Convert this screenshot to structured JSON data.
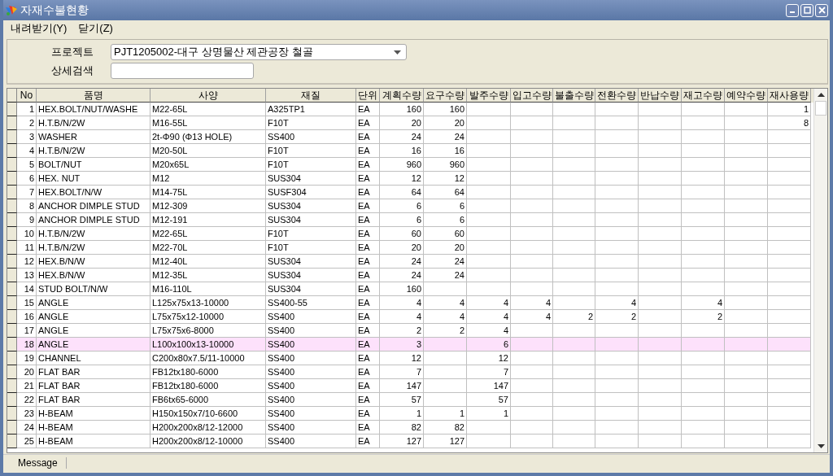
{
  "window": {
    "title": "자재수불현황"
  },
  "menu": [
    "내려받기(Y)",
    "닫기(Z)"
  ],
  "form": {
    "project_label": "프로젝트",
    "project_value": "PJT1205002-대구 상명물산 제관공장 철골",
    "search_label": "상세검색"
  },
  "table": {
    "columns": [
      "No",
      "품명",
      "사양",
      "재질",
      "단위",
      "계획수량",
      "요구수량",
      "발주수량",
      "입고수량",
      "불출수량",
      "전환수량",
      "반납수량",
      "재고수량",
      "예약수량",
      "재사용량"
    ],
    "rows": [
      {
        "selected": false,
        "cells": [
          "1",
          "HEX.BOLT/NUT/WASHE",
          "M22-65L",
          "A325TP1",
          "EA",
          "160",
          "160",
          null,
          null,
          null,
          null,
          null,
          null,
          null,
          "1"
        ]
      },
      {
        "selected": false,
        "cells": [
          "2",
          "H.T.B/N/2W",
          "M16-55L",
          "F10T",
          "EA",
          "20",
          "20",
          null,
          null,
          null,
          null,
          null,
          null,
          null,
          "8"
        ]
      },
      {
        "selected": false,
        "cells": [
          "3",
          "WASHER",
          "2t-Φ90 (Φ13 HOLE)",
          "SS400",
          "EA",
          "24",
          "24",
          null,
          null,
          null,
          null,
          null,
          null,
          null,
          null
        ]
      },
      {
        "selected": false,
        "cells": [
          "4",
          "H.T.B/N/2W",
          "M20-50L",
          "F10T",
          "EA",
          "16",
          "16",
          null,
          null,
          null,
          null,
          null,
          null,
          null,
          null
        ]
      },
      {
        "selected": false,
        "cells": [
          "5",
          "BOLT/NUT",
          "M20x65L",
          "F10T",
          "EA",
          "960",
          "960",
          null,
          null,
          null,
          null,
          null,
          null,
          null,
          null
        ]
      },
      {
        "selected": false,
        "cells": [
          "6",
          "HEX. NUT",
          "M12",
          "SUS304",
          "EA",
          "12",
          "12",
          null,
          null,
          null,
          null,
          null,
          null,
          null,
          null
        ]
      },
      {
        "selected": false,
        "cells": [
          "7",
          "HEX.BOLT/N/W",
          "M14-75L",
          "SUSF304",
          "EA",
          "64",
          "64",
          null,
          null,
          null,
          null,
          null,
          null,
          null,
          null
        ]
      },
      {
        "selected": false,
        "cells": [
          "8",
          "ANCHOR DIMPLE STUD",
          "M12-309",
          "SUS304",
          "EA",
          "6",
          "6",
          null,
          null,
          null,
          null,
          null,
          null,
          null,
          null
        ]
      },
      {
        "selected": false,
        "cells": [
          "9",
          "ANCHOR DIMPLE STUD",
          "M12-191",
          "SUS304",
          "EA",
          "6",
          "6",
          null,
          null,
          null,
          null,
          null,
          null,
          null,
          null
        ]
      },
      {
        "selected": false,
        "cells": [
          "10",
          "H.T.B/N/2W",
          "M22-65L",
          "F10T",
          "EA",
          "60",
          "60",
          null,
          null,
          null,
          null,
          null,
          null,
          null,
          null
        ]
      },
      {
        "selected": false,
        "cells": [
          "11",
          "H.T.B/N/2W",
          "M22-70L",
          "F10T",
          "EA",
          "20",
          "20",
          null,
          null,
          null,
          null,
          null,
          null,
          null,
          null
        ]
      },
      {
        "selected": false,
        "cells": [
          "12",
          "HEX.B/N/W",
          "M12-40L",
          "SUS304",
          "EA",
          "24",
          "24",
          null,
          null,
          null,
          null,
          null,
          null,
          null,
          null
        ]
      },
      {
        "selected": false,
        "cells": [
          "13",
          "HEX.B/N/W",
          "M12-35L",
          "SUS304",
          "EA",
          "24",
          "24",
          null,
          null,
          null,
          null,
          null,
          null,
          null,
          null
        ]
      },
      {
        "selected": false,
        "cells": [
          "14",
          "STUD BOLT/N/W",
          "M16-110L",
          "SUS304",
          "EA",
          "160",
          null,
          null,
          null,
          null,
          null,
          null,
          null,
          null,
          null
        ]
      },
      {
        "selected": false,
        "cells": [
          "15",
          "ANGLE",
          "L125x75x13-10000",
          "SS400-55",
          "EA",
          "4",
          "4",
          "4",
          "4",
          null,
          "4",
          null,
          "4",
          null,
          null
        ]
      },
      {
        "selected": false,
        "cells": [
          "16",
          "ANGLE",
          "L75x75x12-10000",
          "SS400",
          "EA",
          "4",
          "4",
          "4",
          "4",
          "2",
          "2",
          null,
          "2",
          null,
          null
        ]
      },
      {
        "selected": false,
        "cells": [
          "17",
          "ANGLE",
          "L75x75x6-8000",
          "SS400",
          "EA",
          "2",
          "2",
          "4",
          null,
          null,
          null,
          null,
          null,
          null,
          null
        ]
      },
      {
        "selected": true,
        "cells": [
          "18",
          "ANGLE",
          "L100x100x13-10000",
          "SS400",
          "EA",
          "3",
          null,
          "6",
          null,
          null,
          null,
          null,
          null,
          null,
          null
        ]
      },
      {
        "selected": false,
        "cells": [
          "19",
          "CHANNEL",
          "C200x80x7.5/11-10000",
          "SS400",
          "EA",
          "12",
          null,
          "12",
          null,
          null,
          null,
          null,
          null,
          null,
          null
        ]
      },
      {
        "selected": false,
        "cells": [
          "20",
          "FLAT BAR",
          "FB12tx180-6000",
          "SS400",
          "EA",
          "7",
          null,
          "7",
          null,
          null,
          null,
          null,
          null,
          null,
          null
        ]
      },
      {
        "selected": false,
        "cells": [
          "21",
          "FLAT BAR",
          "FB12tx180-6000",
          "SS400",
          "EA",
          "147",
          null,
          "147",
          null,
          null,
          null,
          null,
          null,
          null,
          null
        ]
      },
      {
        "selected": false,
        "cells": [
          "22",
          "FLAT BAR",
          "FB6tx65-6000",
          "SS400",
          "EA",
          "57",
          null,
          "57",
          null,
          null,
          null,
          null,
          null,
          null,
          null
        ]
      },
      {
        "selected": false,
        "cells": [
          "23",
          "H-BEAM",
          "H150x150x7/10-6600",
          "SS400",
          "EA",
          "1",
          "1",
          "1",
          null,
          null,
          null,
          null,
          null,
          null,
          null
        ]
      },
      {
        "selected": false,
        "cells": [
          "24",
          "H-BEAM",
          "H200x200x8/12-12000",
          "SS400",
          "EA",
          "82",
          "82",
          null,
          null,
          null,
          null,
          null,
          null,
          null,
          null
        ]
      },
      {
        "selected": false,
        "cells": [
          "25",
          "H-BEAM",
          "H200x200x8/12-10000",
          "SS400",
          "EA",
          "127",
          "127",
          null,
          null,
          null,
          null,
          null,
          null,
          null,
          null
        ]
      }
    ]
  },
  "status_bar": {
    "label": "Message"
  }
}
